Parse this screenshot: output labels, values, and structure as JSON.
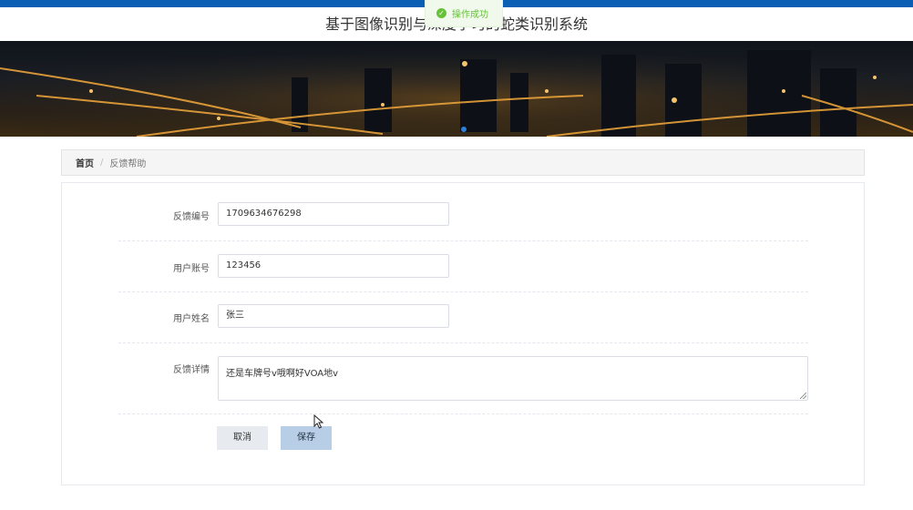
{
  "site": {
    "title": "基于图像识别与深度学习的蛇类识别系统"
  },
  "toast": {
    "message": "操作成功",
    "icon": "check-circle-icon",
    "color": "#67c23a"
  },
  "breadcrumb": {
    "home": "首页",
    "separator": "/",
    "current": "反馈帮助"
  },
  "form": {
    "fields": [
      {
        "label": "反馈编号",
        "value": "1709634676298"
      },
      {
        "label": "用户账号",
        "value": "123456"
      },
      {
        "label": "用户姓名",
        "value": "张三"
      },
      {
        "label": "反馈详情",
        "value": "还是车牌号v哦啊好VOA地v"
      }
    ],
    "cancel_label": "取消",
    "save_label": "保存"
  },
  "colors": {
    "topbar": "#0a5fb4",
    "save_button": "#b8cee6",
    "cancel_button": "#e7ebf0"
  }
}
